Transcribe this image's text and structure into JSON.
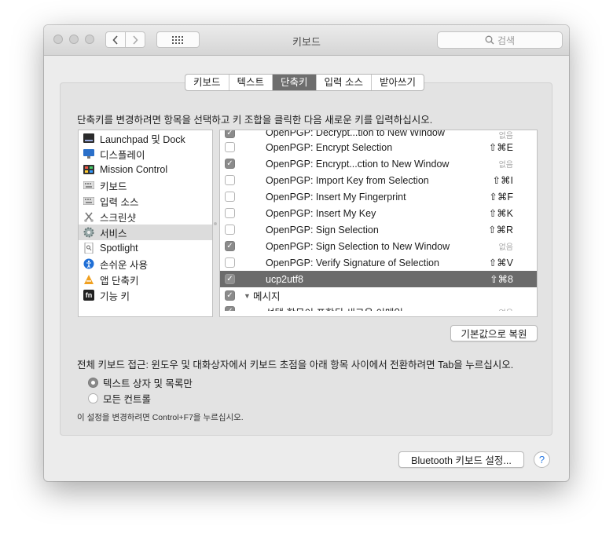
{
  "window": {
    "title": "키보드"
  },
  "toolbar": {
    "search_placeholder": "검색"
  },
  "tabs": [
    {
      "label": "키보드"
    },
    {
      "label": "텍스트"
    },
    {
      "label": "단축키",
      "active": true
    },
    {
      "label": "입력 소스"
    },
    {
      "label": "받아쓰기"
    }
  ],
  "instructions": "단축키를 변경하려면 항목을 선택하고 키 조합을 클릭한 다음 새로운 키를 입력하십시오.",
  "categories": [
    {
      "label": "Launchpad 및 Dock",
      "icon": "launchpad-icon"
    },
    {
      "label": "디스플레이",
      "icon": "display-icon"
    },
    {
      "label": "Mission Control",
      "icon": "mission-control-icon"
    },
    {
      "label": "키보드",
      "icon": "keyboard-icon"
    },
    {
      "label": "입력 소스",
      "icon": "input-source-icon"
    },
    {
      "label": "스크린샷",
      "icon": "screenshot-icon"
    },
    {
      "label": "서비스",
      "icon": "services-gear-icon",
      "selected": true
    },
    {
      "label": "Spotlight",
      "icon": "spotlight-icon"
    },
    {
      "label": "손쉬운 사용",
      "icon": "accessibility-icon"
    },
    {
      "label": "앱 단축키",
      "icon": "app-shortcuts-icon"
    },
    {
      "label": "기능 키",
      "icon": "fn-key-icon"
    }
  ],
  "shortcuts": [
    {
      "name": "OpenPGP: Decrypt...tion to New Window",
      "key": "없음",
      "checked": true
    },
    {
      "name": "OpenPGP: Encrypt Selection",
      "key": "⇧⌘E",
      "checked": false
    },
    {
      "name": "OpenPGP: Encrypt...ction to New Window",
      "key": "없음",
      "checked": true
    },
    {
      "name": "OpenPGP: Import Key from Selection",
      "key": "⇧⌘I",
      "checked": false
    },
    {
      "name": "OpenPGP: Insert My Fingerprint",
      "key": "⇧⌘F",
      "checked": false
    },
    {
      "name": "OpenPGP: Insert My Key",
      "key": "⇧⌘K",
      "checked": false
    },
    {
      "name": "OpenPGP: Sign Selection",
      "key": "⇧⌘R",
      "checked": false
    },
    {
      "name": "OpenPGP: Sign Selection to New Window",
      "key": "없음",
      "checked": true
    },
    {
      "name": "OpenPGP: Verify Signature of Selection",
      "key": "⇧⌘V",
      "checked": false
    },
    {
      "name": "ucp2utf8",
      "key": "⇧⌘8",
      "checked": true,
      "selected": true
    }
  ],
  "group": {
    "name": "메시지",
    "checked": true
  },
  "partial_row": {
    "name": "선택 항목이 포함된 새로운 이메일",
    "key": "없음"
  },
  "restore_defaults": "기본값으로 복원",
  "full_keyboard_access": "전체 키보드 접근: 윈도우 및 대화상자에서 키보드 초점을 아래 항목 사이에서 전환하려면 Tab을 누르십시오.",
  "radios": [
    {
      "label": "텍스트 상자 및 목록만",
      "selected": true
    },
    {
      "label": "모든 컨트롤",
      "selected": false
    }
  ],
  "note": "이 설정을 변경하려면 Control+F7을 누르십시오.",
  "bluetooth_button": "Bluetooth 키보드 설정...",
  "help": "?"
}
